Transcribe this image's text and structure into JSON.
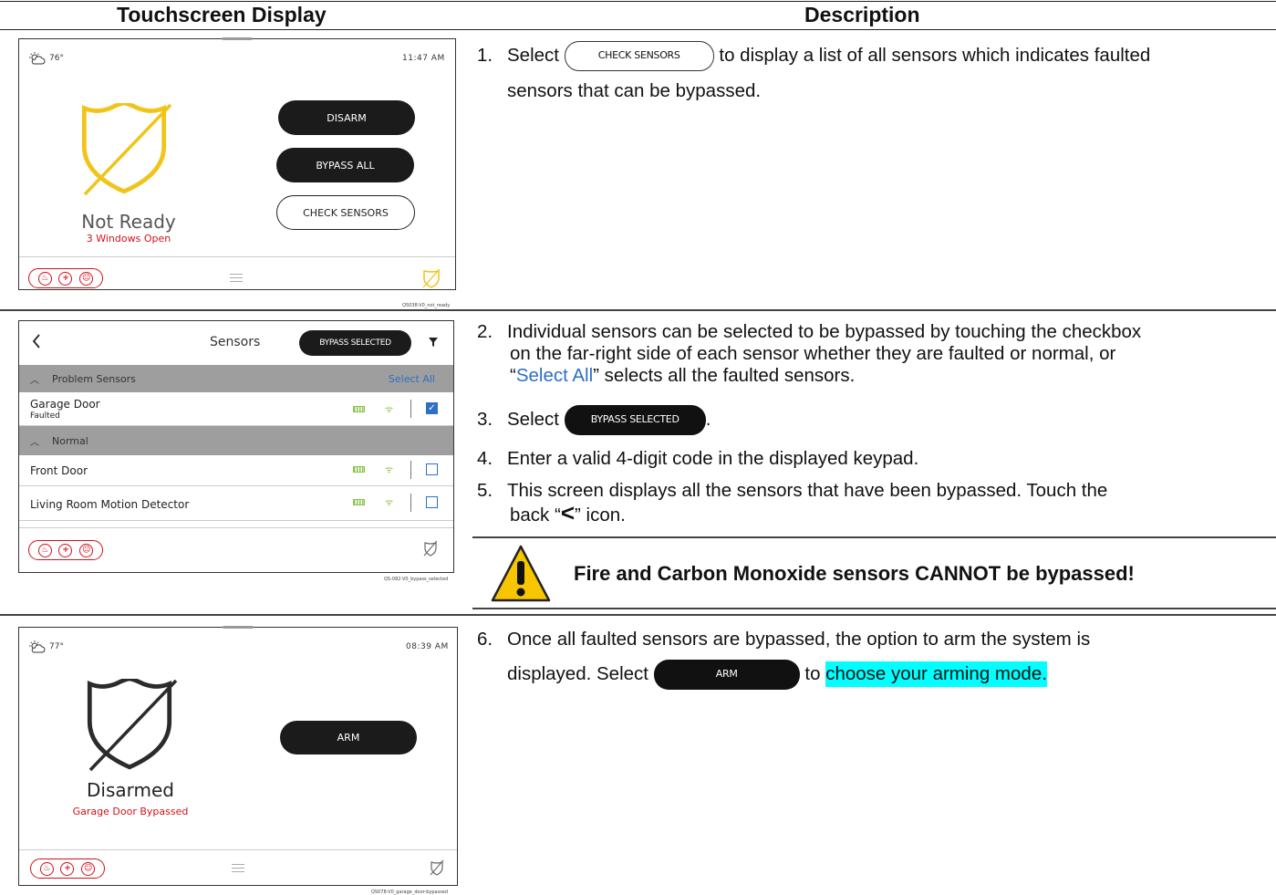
{
  "table": {
    "col1_header": "Touchscreen Display",
    "col2_header": "Description"
  },
  "screen1": {
    "temp": "76°",
    "time": "11:47 AM",
    "buttons": {
      "disarm": "DISARM",
      "bypass_all": "BYPASS ALL",
      "check_sensors": "CHECK SENSORS"
    },
    "status": "Not Ready",
    "substatus": "3 Windows Open",
    "shield_color": "#f0c419",
    "caption": "QS038-V0_not_ready"
  },
  "screen2": {
    "title": "Sensors",
    "bypass_selected": "BYPASS SELECTED",
    "group1": "Problem Sensors",
    "select_all": "Select All",
    "group2": "Normal",
    "rows": [
      {
        "name": "Garage Door",
        "sub": "Faulted"
      },
      {
        "name": "Front Door",
        "sub": ""
      },
      {
        "name": "Living Room Motion Detector",
        "sub": ""
      }
    ],
    "caption": "QS-082-V0_bypass_selected"
  },
  "screen3": {
    "temp": "77°",
    "time": "08:39 AM",
    "arm": "ARM",
    "status": "Disarmed",
    "substatus": "Garage Door Bypassed",
    "caption": "QS078-V0_garage_door-bypassed"
  },
  "steps": {
    "s1_num": "1.",
    "s1_a": "Select",
    "s1_btn": "CHECK SENSORS",
    "s1_b": "to display a list of all sensors which indicates faulted",
    "s1_c": "sensors that can be bypassed.",
    "s2_num": "2.",
    "s2_a": "Individual sensors can be selected to be bypassed by touching the checkbox",
    "s2_b": "on the far-right side of each sensor whether they are faulted or normal, or",
    "s2_q1": "“",
    "s2_link": "Select All",
    "s2_c": "” selects all the faulted sensors.",
    "s3_num": "3.",
    "s3_a": "Select",
    "s3_btn": "BYPASS SELECTED",
    "s3_end": ".",
    "s4_num": "4.",
    "s4_a": "Enter a valid 4-digit code in the displayed keypad.",
    "s5_num": "5.",
    "s5_a": "This screen displays all the sensors that have been bypassed.  Touch the",
    "s5_b1": "back “",
    "s5_back": "<",
    "s5_b2": "” icon.",
    "warning": "Fire and Carbon Monoxide sensors CANNOT be bypassed!",
    "s6_num": "6.",
    "s6_a": "Once all faulted sensors are bypassed, the option to arm the system is",
    "s6_b": "displayed.  Select",
    "s6_btn": "ARM",
    "s6_c": "to",
    "s6_hl": "choose your arming mode."
  }
}
